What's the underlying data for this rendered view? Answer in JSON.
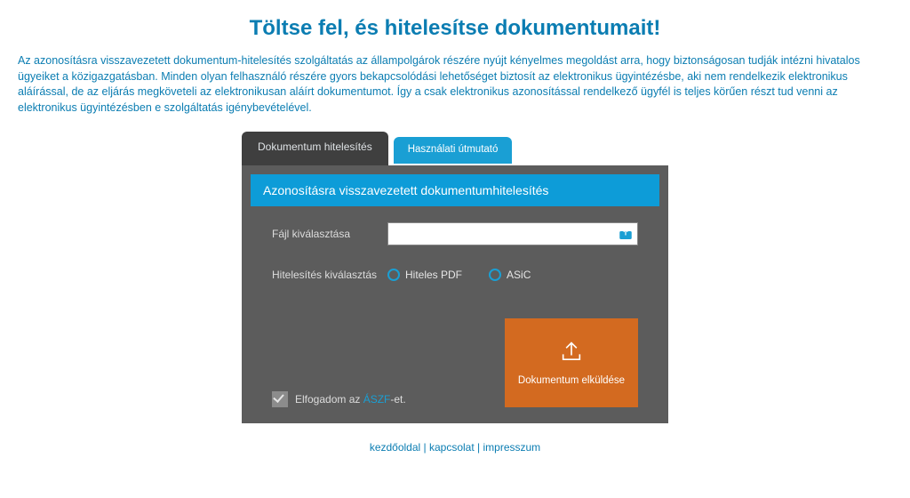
{
  "title": "Töltse fel, és hitelesítse dokumentumait!",
  "intro": "Az azonosításra visszavezetett dokumentum-hitelesítés szolgáltatás az állampolgárok részére nyújt kényelmes megoldást arra, hogy biztonságosan tudják intézni hivatalos ügyeiket a közigazgatásban. Minden olyan felhasználó részére gyors bekapcsolódási lehetőséget biztosít az elektronikus ügyintézésbe, aki nem rendelkezik elektronikus aláírással, de az eljárás megköveteli az elektronikusan aláírt dokumentumot. Így a csak elektronikus azonosítással rendelkező ügyfél is teljes körűen részt tud venni az elektronikus ügyintézésben e szolgáltatás igénybevételével.",
  "tabs": {
    "active": "Dokumentum hitelesítés",
    "inactive": "Használati útmutató"
  },
  "banner": "Azonosításra visszavezetett dokumentumhitelesítés",
  "form": {
    "file_label": "Fájl kiválasztása",
    "auth_label": "Hitelesítés kiválasztás",
    "radio1": "Hiteles PDF",
    "radio2": "ASiC",
    "accept_pre": "Elfogadom az ",
    "accept_link": "ÁSZF",
    "accept_post": "-et.",
    "submit": "Dokumentum elküldése"
  },
  "footer": {
    "a": "kezdőoldal",
    "b": "kapcsolat",
    "c": "impresszum"
  }
}
